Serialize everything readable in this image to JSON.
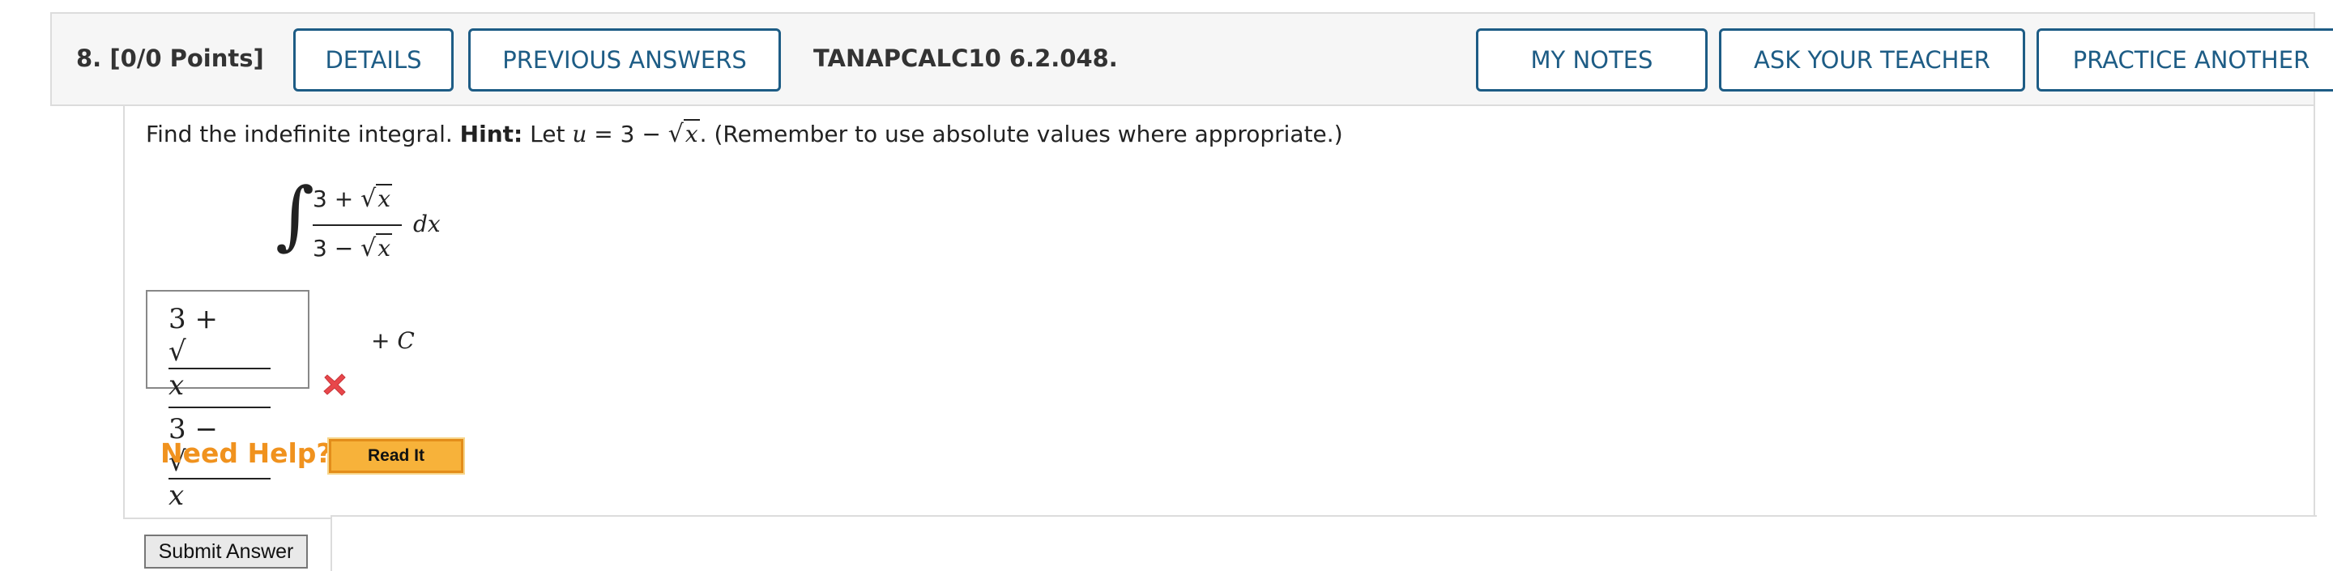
{
  "header": {
    "question_number": "8.",
    "points": "[0/0 Points]",
    "details_label": "DETAILS",
    "previous_answers_label": "PREVIOUS ANSWERS",
    "question_id": "TANAPCALC10 6.2.048.",
    "my_notes_label": "MY NOTES",
    "ask_teacher_label": "ASK YOUR TEACHER",
    "practice_another_label": "PRACTICE ANOTHER"
  },
  "prompt": {
    "lead": "Find the indefinite integral.",
    "hint_label": "Hint:",
    "hint_text_a": "Let",
    "var_u": "u",
    "hint_eq": "= 3 −",
    "var_x": "x",
    "tail": ". (Remember to use absolute values where appropriate.)"
  },
  "integral": {
    "numerator_prefix": "3 +",
    "denominator_prefix": "3 −",
    "var": "x",
    "differential": "dx"
  },
  "answer": {
    "numerator_prefix": "3 +",
    "denominator_prefix": "3 −",
    "var": "x",
    "plus_c": "+",
    "c": "C",
    "status": "incorrect"
  },
  "help": {
    "need_help_label": "Need Help?",
    "read_it_label": "Read It"
  },
  "actions": {
    "submit_label": "Submit Answer"
  },
  "colors": {
    "button_blue": "#1d5c85",
    "help_orange": "#f0921e",
    "error_red": "#e8474b"
  }
}
